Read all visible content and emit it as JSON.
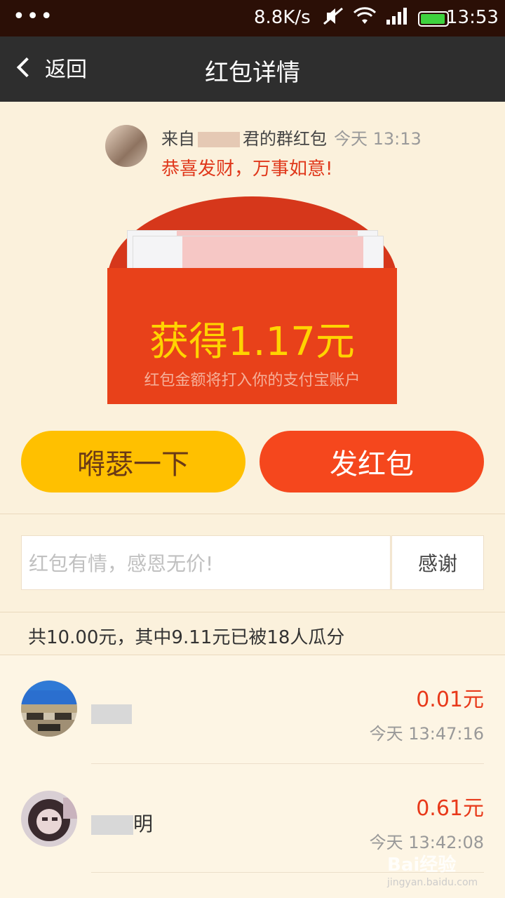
{
  "status_bar": {
    "dots": "•••",
    "speed": "8.8K/s",
    "time": "13:53"
  },
  "nav": {
    "back_label": "返回",
    "title": "红包详情"
  },
  "sender": {
    "from_prefix": "来自",
    "from_suffix": "君的群红包",
    "time": "今天 13:13",
    "blessing": "恭喜发财，万事如意!"
  },
  "envelope": {
    "amount_text": "获得1.17元",
    "note": "红包金额将打入你的支付宝账户"
  },
  "actions": {
    "left_label": "嘚瑟一下",
    "right_label": "发红包"
  },
  "thanks": {
    "placeholder": "红包有情，感恩无价!",
    "button_label": "感谢"
  },
  "summary": "共10.00元，其中9.11元已被18人瓜分",
  "records": [
    {
      "name_visible": "",
      "amount": "0.01元",
      "time": "今天 13:47:16"
    },
    {
      "name_visible": "明",
      "amount": "0.61元",
      "time": "今天 13:42:08"
    }
  ],
  "watermark": {
    "main": "Bai经验",
    "sub": "jingyan.baidu.com"
  },
  "colors": {
    "accent_red": "#e8411a",
    "amount_yellow": "#ffd400",
    "button_yellow": "#ffc000",
    "button_red": "#f5471d",
    "nav_bg": "#2e2e2e",
    "page_bg": "#fbf1dc"
  }
}
